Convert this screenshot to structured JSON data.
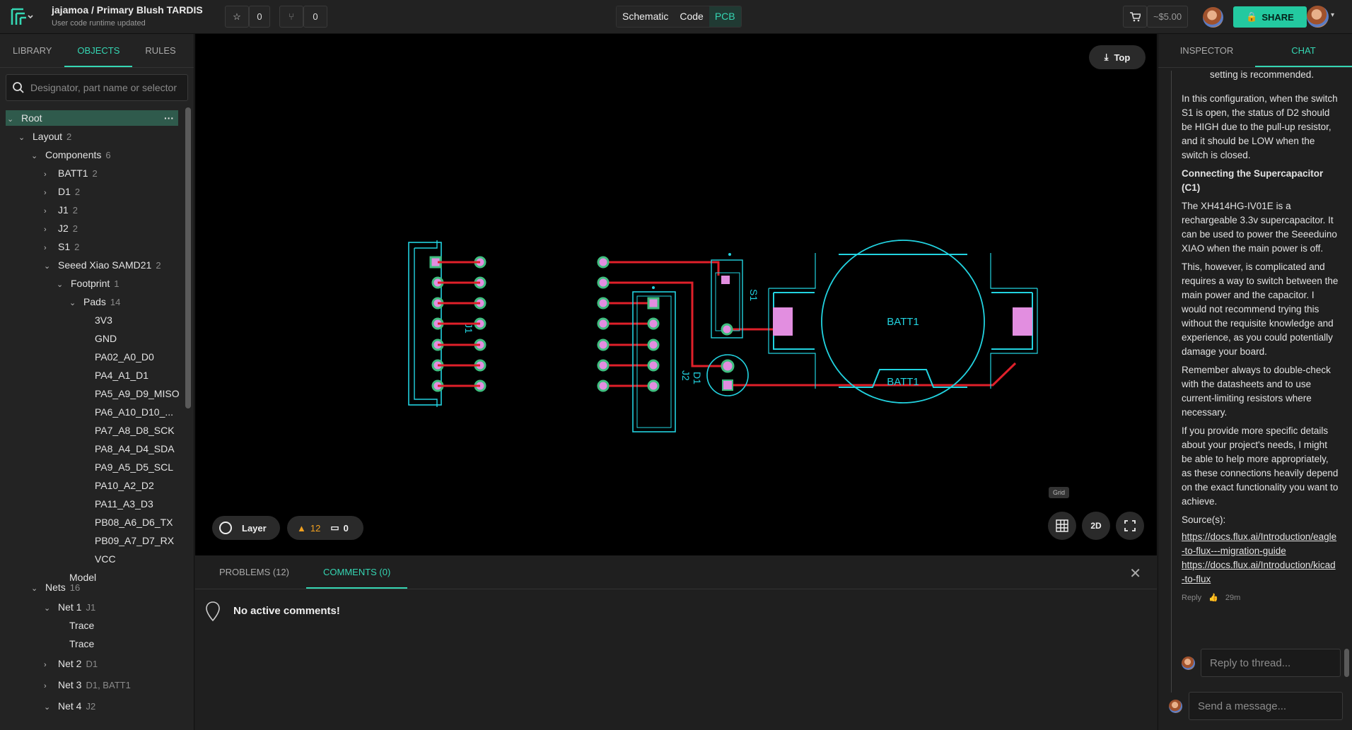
{
  "header": {
    "project_title": "jajamoa / Primary Blush TARDIS",
    "project_subtitle": "User code runtime updated",
    "stars_count": "0",
    "forks_count": "0",
    "modes": [
      "Schematic",
      "Code",
      "PCB"
    ],
    "active_mode": "PCB",
    "cost": "~$5.00",
    "share_label": "SHARE"
  },
  "left_panel": {
    "tabs": [
      "LIBRARY",
      "OBJECTS",
      "RULES"
    ],
    "active_tab": "OBJECTS",
    "search_placeholder": "Designator, part name or selector",
    "tree": [
      {
        "label": "Root",
        "count": "",
        "chev": "v",
        "selected": true
      },
      {
        "label": "Layout",
        "count": "2",
        "chev": "v"
      },
      {
        "label": "Components",
        "count": "6",
        "chev": "v"
      },
      {
        "label": "BATT1",
        "count": "2",
        "chev": ">"
      },
      {
        "label": "D1",
        "count": "2",
        "chev": ">"
      },
      {
        "label": "J1",
        "count": "2",
        "chev": ">"
      },
      {
        "label": "J2",
        "count": "2",
        "chev": ">"
      },
      {
        "label": "S1",
        "count": "2",
        "chev": ">"
      },
      {
        "label": "Seeed Xiao SAMD21",
        "count": "2",
        "chev": "v"
      },
      {
        "label": "Footprint",
        "count": "1",
        "chev": "v"
      },
      {
        "label": "Pads",
        "count": "14",
        "chev": "v"
      },
      {
        "label": "3V3",
        "count": "",
        "chev": ""
      },
      {
        "label": "GND",
        "count": "",
        "chev": ""
      },
      {
        "label": "PA02_A0_D0",
        "count": "",
        "chev": ""
      },
      {
        "label": "PA4_A1_D1",
        "count": "",
        "chev": ""
      },
      {
        "label": "PA5_A9_D9_MISO",
        "count": "",
        "chev": ""
      },
      {
        "label": "PA6_A10_D10_...",
        "count": "",
        "chev": ""
      },
      {
        "label": "PA7_A8_D8_SCK",
        "count": "",
        "chev": ""
      },
      {
        "label": "PA8_A4_D4_SDA",
        "count": "",
        "chev": ""
      },
      {
        "label": "PA9_A5_D5_SCL",
        "count": "",
        "chev": ""
      },
      {
        "label": "PA10_A2_D2",
        "count": "",
        "chev": ""
      },
      {
        "label": "PA11_A3_D3",
        "count": "",
        "chev": ""
      },
      {
        "label": "PB08_A6_D6_TX",
        "count": "",
        "chev": ""
      },
      {
        "label": "PB09_A7_D7_RX",
        "count": "",
        "chev": ""
      },
      {
        "label": "VCC",
        "count": "",
        "chev": ""
      },
      {
        "label": "Model",
        "count": "",
        "chev": ""
      },
      {
        "label": "Nets",
        "count": "16",
        "chev": "v"
      },
      {
        "label": "Net 1",
        "count": "J1",
        "chev": "v"
      },
      {
        "label": "Trace",
        "count": "",
        "chev": ""
      },
      {
        "label": "Trace",
        "count": "",
        "chev": ""
      },
      {
        "label": "Net 2",
        "count": "D1",
        "chev": ">"
      },
      {
        "label": "Net 3",
        "count": "D1, BATT1",
        "chev": ">"
      },
      {
        "label": "Net 4",
        "count": "J2",
        "chev": "v"
      }
    ]
  },
  "canvas": {
    "view_label": "Top",
    "layer_label": "Layer",
    "warnings_count": "12",
    "comments_count": "0",
    "grid_tooltip": "Grid",
    "view_mode_label": "2D",
    "labels": {
      "j1": "J1",
      "j2": "J2",
      "s1": "S1",
      "d1": "D1",
      "batt_top": "BATT1",
      "batt_bottom": "BATT1"
    }
  },
  "bottom_panel": {
    "tabs": [
      "PROBLEMS (12)",
      "COMMENTS (0)"
    ],
    "active_tab": "COMMENTS (0)",
    "empty_text": "No active comments!"
  },
  "right_panel": {
    "tabs": [
      "INSPECTOR",
      "CHAT"
    ],
    "active_tab": "CHAT",
    "messages": [
      "setting is recommended.",
      "In this configuration, when the switch S1 is open, the status of D2 should be HIGH due to the pull-up resistor, and it should be LOW when the switch is closed.",
      "Connecting the Supercapacitor (C1)",
      "The XH414HG-IV01E is a rechargeable 3.3v supercapacitor. It can be used to power the Seeeduino XIAO when the main power is off.",
      "This, however, is complicated and requires a way to switch between the main power and the capacitor. I would not recommend trying this without the requisite knowledge and experience, as you could potentially damage your board.",
      "Remember always to double-check with the datasheets and to use current-limiting resistors where necessary.",
      "If you provide more specific details about your project's needs, I might be able to help more appropriately, as these connections heavily depend on the exact functionality you want to achieve.",
      "Source(s):"
    ],
    "links": [
      "https://docs.flux.ai/Introduction/eagle-to-flux---migration-guide",
      "https://docs.flux.ai/Introduction/kicad-to-flux"
    ],
    "reply_label": "Reply",
    "time_ago": "29m",
    "reply_placeholder": "Reply to thread...",
    "message_placeholder": "Send a message..."
  },
  "colors": {
    "accent": "#35d6b3",
    "silkscreen": "#22d3e0",
    "trace": "#e0202a",
    "pad": "#e28ee0"
  }
}
